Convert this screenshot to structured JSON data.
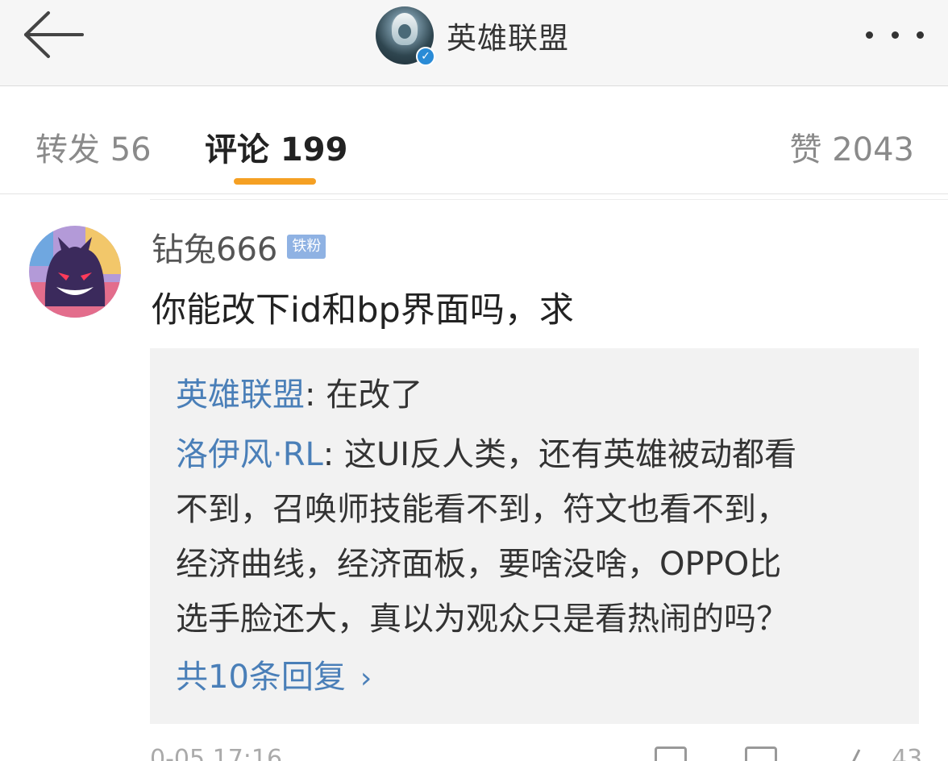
{
  "header": {
    "title": "英雄联盟",
    "verified_icon": "verified-check-icon",
    "back_icon": "arrow-left-icon",
    "more_icon": "more-dots-icon"
  },
  "tabs": {
    "repost": "转发 56",
    "comment": "评论 199",
    "like": "赞 2043",
    "active_color": "#f5a023"
  },
  "comment": {
    "username": "钻兔666",
    "fan_badge": "铁粉",
    "text": "你能改下id和bp界面吗，求",
    "timestamp_partial": "0-05 17:16",
    "like_count_partial": "43",
    "replies": [
      {
        "user": "英雄联盟",
        "sep": ": ",
        "text": "在改了"
      },
      {
        "user": "洛伊风·RL",
        "sep": ": ",
        "text": "这UI反人类，还有英雄被动都看"
      }
    ],
    "reply_continuation": [
      "不到，召唤师技能看不到，符文也看不到，",
      "经济曲线，经济面板，要啥没啥，OPPO比",
      "选手脸还大，真以为观众只是看热闹的吗？"
    ],
    "more_replies": "共10条回复",
    "more_replies_chevron": "›"
  },
  "colors": {
    "link_blue": "#4a7fb8",
    "badge_blue": "#8fb2e3",
    "reply_bg": "#f2f2f2"
  }
}
